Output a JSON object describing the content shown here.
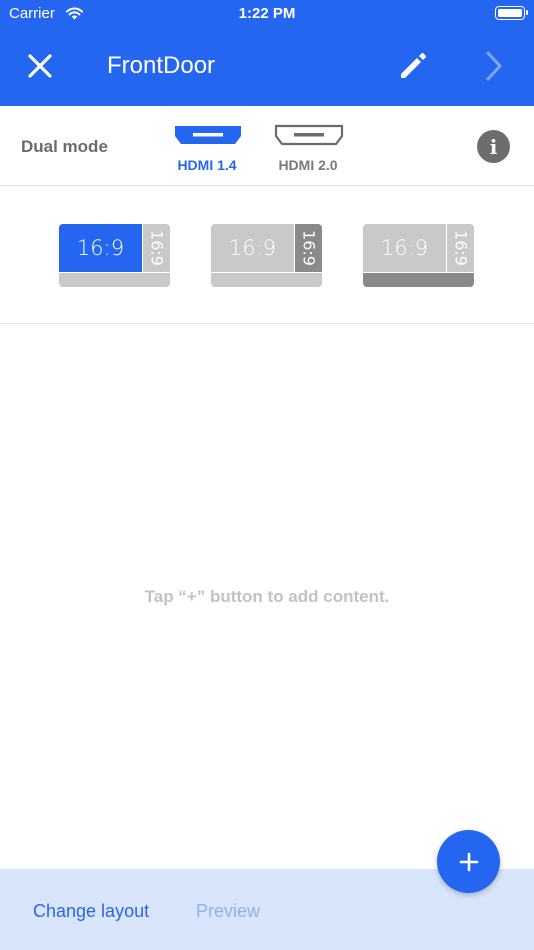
{
  "status_bar": {
    "carrier": "Carrier",
    "time": "1:22 PM"
  },
  "nav": {
    "title": "FrontDoor",
    "close_icon": "close-icon",
    "edit_icon": "pencil-icon",
    "next_icon": "chevron-right-icon"
  },
  "mode": {
    "label": "Dual mode",
    "options": [
      {
        "label": "HDMI 1.4",
        "selected": true
      },
      {
        "label": "HDMI 2.0",
        "selected": false
      }
    ],
    "info_glyph": "i"
  },
  "layouts": [
    {
      "main_ratio": "16:9",
      "side_ratio": "16:9",
      "selected": true
    },
    {
      "main_ratio": "16:9",
      "side_ratio": "16:9",
      "selected": false
    },
    {
      "main_ratio": "16:9",
      "side_ratio": "16:9",
      "selected": false
    }
  ],
  "empty_hint": "Tap “+” button to add content.",
  "bottom": {
    "change_layout": "Change layout",
    "preview": "Preview"
  },
  "fab": {
    "icon": "plus-icon"
  },
  "colors": {
    "primary": "#2566f0",
    "bottom_bar": "#d9e5fb",
    "inactive_gray": "#c9c9c9",
    "dark_gray": "#8a8a8a"
  }
}
